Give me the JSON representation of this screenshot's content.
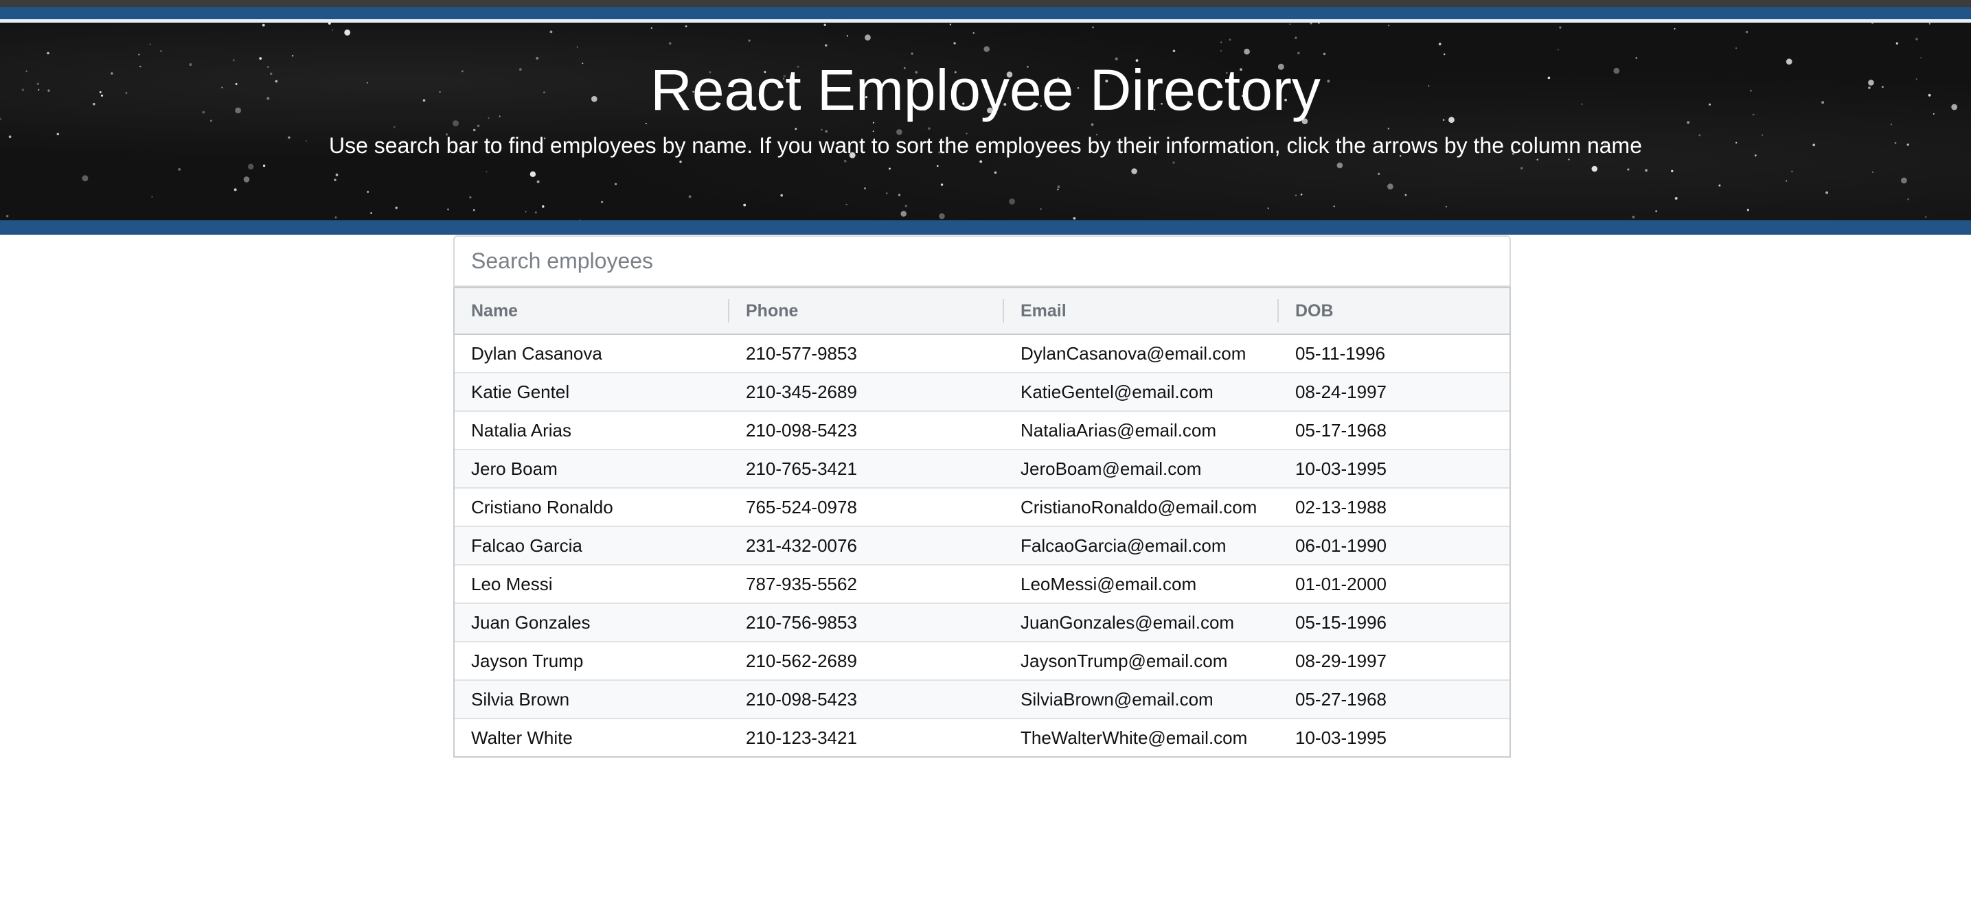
{
  "header": {
    "title": "React Employee Directory",
    "subtitle": "Use search bar to find employees by name. If you want to sort the employees by their information, click the arrows by the column name"
  },
  "search": {
    "placeholder": "Search employees",
    "value": ""
  },
  "table": {
    "columns": [
      "Name",
      "Phone",
      "Email",
      "DOB"
    ],
    "rows": [
      [
        "Dylan Casanova",
        "210-577-9853",
        "DylanCasanova@email.com",
        "05-11-1996"
      ],
      [
        "Katie Gentel",
        "210-345-2689",
        "KatieGentel@email.com",
        "08-24-1997"
      ],
      [
        "Natalia Arias",
        "210-098-5423",
        "NataliaArias@email.com",
        "05-17-1968"
      ],
      [
        "Jero Boam",
        "210-765-3421",
        "JeroBoam@email.com",
        "10-03-1995"
      ],
      [
        "Cristiano Ronaldo",
        "765-524-0978",
        "CristianoRonaldo@email.com",
        "02-13-1988"
      ],
      [
        "Falcao Garcia",
        "231-432-0076",
        "FalcaoGarcia@email.com",
        "06-01-1990"
      ],
      [
        "Leo Messi",
        "787-935-5562",
        "LeoMessi@email.com",
        "01-01-2000"
      ],
      [
        "Juan Gonzales",
        "210-756-9853",
        "JuanGonzales@email.com",
        "05-15-1996"
      ],
      [
        "Jayson Trump",
        "210-562-2689",
        "JaysonTrump@email.com",
        "08-29-1997"
      ],
      [
        "Silvia Brown",
        "210-098-5423",
        "SilviaBrown@email.com",
        "05-27-1968"
      ],
      [
        "Walter White",
        "210-123-3421",
        "TheWalterWhite@email.com",
        "10-03-1995"
      ]
    ]
  },
  "colors": {
    "band": "#215587",
    "hero_background": "#121212",
    "header_text": "#ffffff"
  }
}
